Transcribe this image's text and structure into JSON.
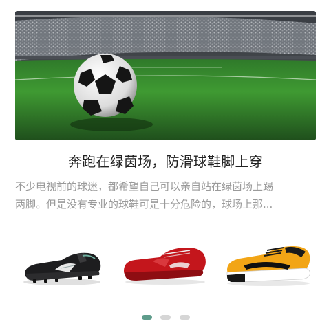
{
  "hero": {
    "image": "soccer-ball-in-stadium"
  },
  "article": {
    "title": "奔跑在绿茵场，防滑球鞋脚上穿",
    "summary_line1": "不少电视前的球迷，都希望自己可以亲自站在绿茵场上踢",
    "summary_line2": "两脚。但是没有专业的球鞋可是十分危险的，球场上那..."
  },
  "products": [
    {
      "image": "black-soccer-cleat"
    },
    {
      "image": "red-soccer-shoe"
    },
    {
      "image": "yellow-futsal-shoe"
    }
  ],
  "pager": {
    "count": 3,
    "active_index": 0,
    "colors": {
      "active": "#5e9c8b",
      "inactive": "#d6d6d6"
    }
  }
}
